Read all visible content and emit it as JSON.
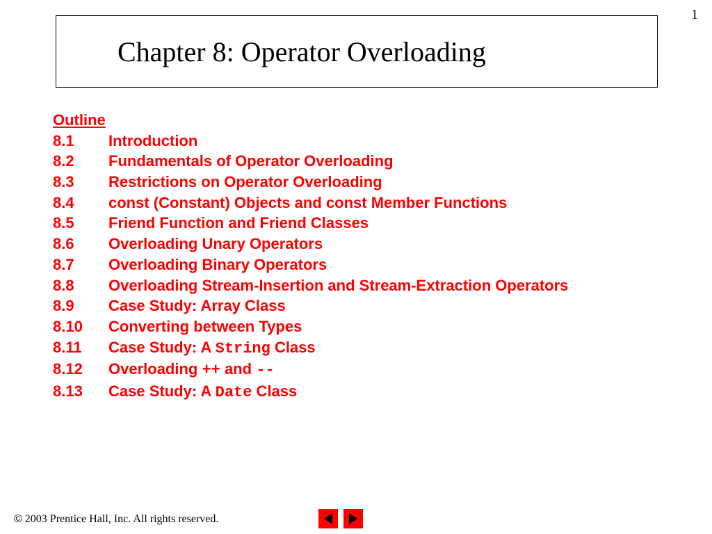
{
  "page_number": "1",
  "title": "Chapter 8: Operator Overloading",
  "outline": {
    "heading": "Outline",
    "items": [
      {
        "num": "8.1",
        "segments": [
          {
            "t": "Introduction",
            "mono": false
          }
        ]
      },
      {
        "num": "8.2",
        "segments": [
          {
            "t": "Fundamentals of Operator Overloading",
            "mono": false
          }
        ]
      },
      {
        "num": "8.3",
        "segments": [
          {
            "t": "Restrictions on Operator Overloading",
            "mono": false
          }
        ]
      },
      {
        "num": "8.4",
        "segments": [
          {
            "t": "const (Constant) Objects and const Member Functions",
            "mono": false
          }
        ]
      },
      {
        "num": "8.5",
        "segments": [
          {
            "t": "Friend Function and Friend Classes",
            "mono": false
          }
        ]
      },
      {
        "num": "8.6",
        "segments": [
          {
            "t": "Overloading Unary Operators",
            "mono": false
          }
        ]
      },
      {
        "num": "8.7",
        "segments": [
          {
            "t": "Overloading Binary Operators",
            "mono": false
          }
        ]
      },
      {
        "num": "8.8",
        "segments": [
          {
            "t": "Overloading Stream-Insertion and Stream-Extraction Operators",
            "mono": false
          }
        ]
      },
      {
        "num": "8.9",
        "segments": [
          {
            "t": "Case Study: Array Class",
            "mono": false
          }
        ]
      },
      {
        "num": "8.10",
        "segments": [
          {
            "t": "Converting between Types",
            "mono": false
          }
        ]
      },
      {
        "num": "8.11",
        "segments": [
          {
            "t": "Case Study: A ",
            "mono": false
          },
          {
            "t": "String",
            "mono": true
          },
          {
            "t": " Class",
            "mono": false
          }
        ]
      },
      {
        "num": "8.12",
        "segments": [
          {
            "t": "Overloading ",
            "mono": false
          },
          {
            "t": "++",
            "mono": true
          },
          {
            "t": " and ",
            "mono": false
          },
          {
            "t": "--",
            "mono": true
          }
        ]
      },
      {
        "num": "8.13",
        "segments": [
          {
            "t": "Case Study: A ",
            "mono": false
          },
          {
            "t": "Date",
            "mono": true
          },
          {
            "t": " Class",
            "mono": false
          }
        ]
      }
    ]
  },
  "footer": {
    "copyright_symbol": "©",
    "text": " 2003 Prentice Hall, Inc.  All rights reserved."
  }
}
